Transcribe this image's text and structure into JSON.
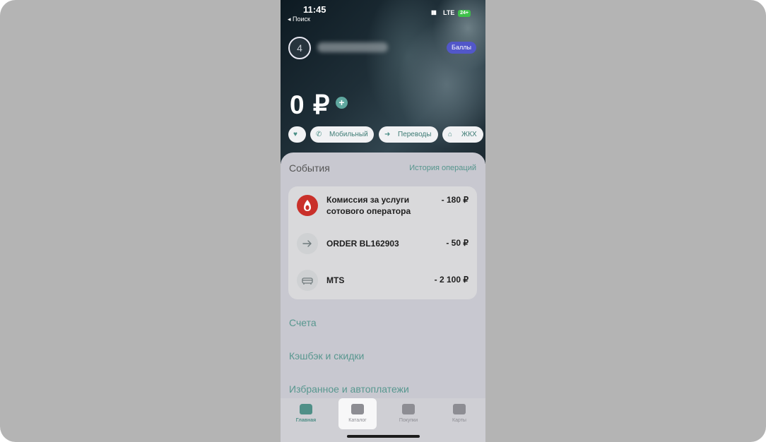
{
  "status_bar": {
    "time": "11:45",
    "back_label": "◂ Поиск",
    "network": "LTE",
    "battery": "24+"
  },
  "profile": {
    "avatar_text": "4",
    "points_badge": "Баллы"
  },
  "balance": {
    "amount": "0 ₽",
    "add_icon": "+"
  },
  "quick_actions": [
    {
      "icon": "heart-icon",
      "label": ""
    },
    {
      "icon": "phone-icon",
      "label": "Мобильный"
    },
    {
      "icon": "arrow-right-icon",
      "label": "Переводы"
    },
    {
      "icon": "home-icon",
      "label": "ЖКХ"
    }
  ],
  "events": {
    "title": "События",
    "history_link": "История операций",
    "items": [
      {
        "icon": "drop-logo-icon",
        "line1": "Комиссия за услуги",
        "line2": "сотового оператора",
        "amount": "- 180 ₽"
      },
      {
        "icon": "arrow-right-icon",
        "line1": "ORDER BL162903",
        "line2": "",
        "amount": "- 50 ₽"
      },
      {
        "icon": "sofa-icon",
        "line1": "MTS",
        "line2": "",
        "amount": "- 2 100 ₽"
      }
    ]
  },
  "sections": {
    "accounts": "Счета",
    "cashback": "Кэшбэк и скидки",
    "favorites": "Избранное и автоплатежи"
  },
  "tabbar": [
    {
      "label": "Главная",
      "icon": "home-icon",
      "active": true
    },
    {
      "label": "Каталог",
      "icon": "catalog-icon",
      "selected": true
    },
    {
      "label": "Покупки",
      "icon": "bag-icon"
    },
    {
      "label": "Карты",
      "icon": "card-icon"
    }
  ],
  "colors": {
    "accent": "#58978f",
    "badge": "#5257c9",
    "sheet": "#c8c8d0"
  }
}
